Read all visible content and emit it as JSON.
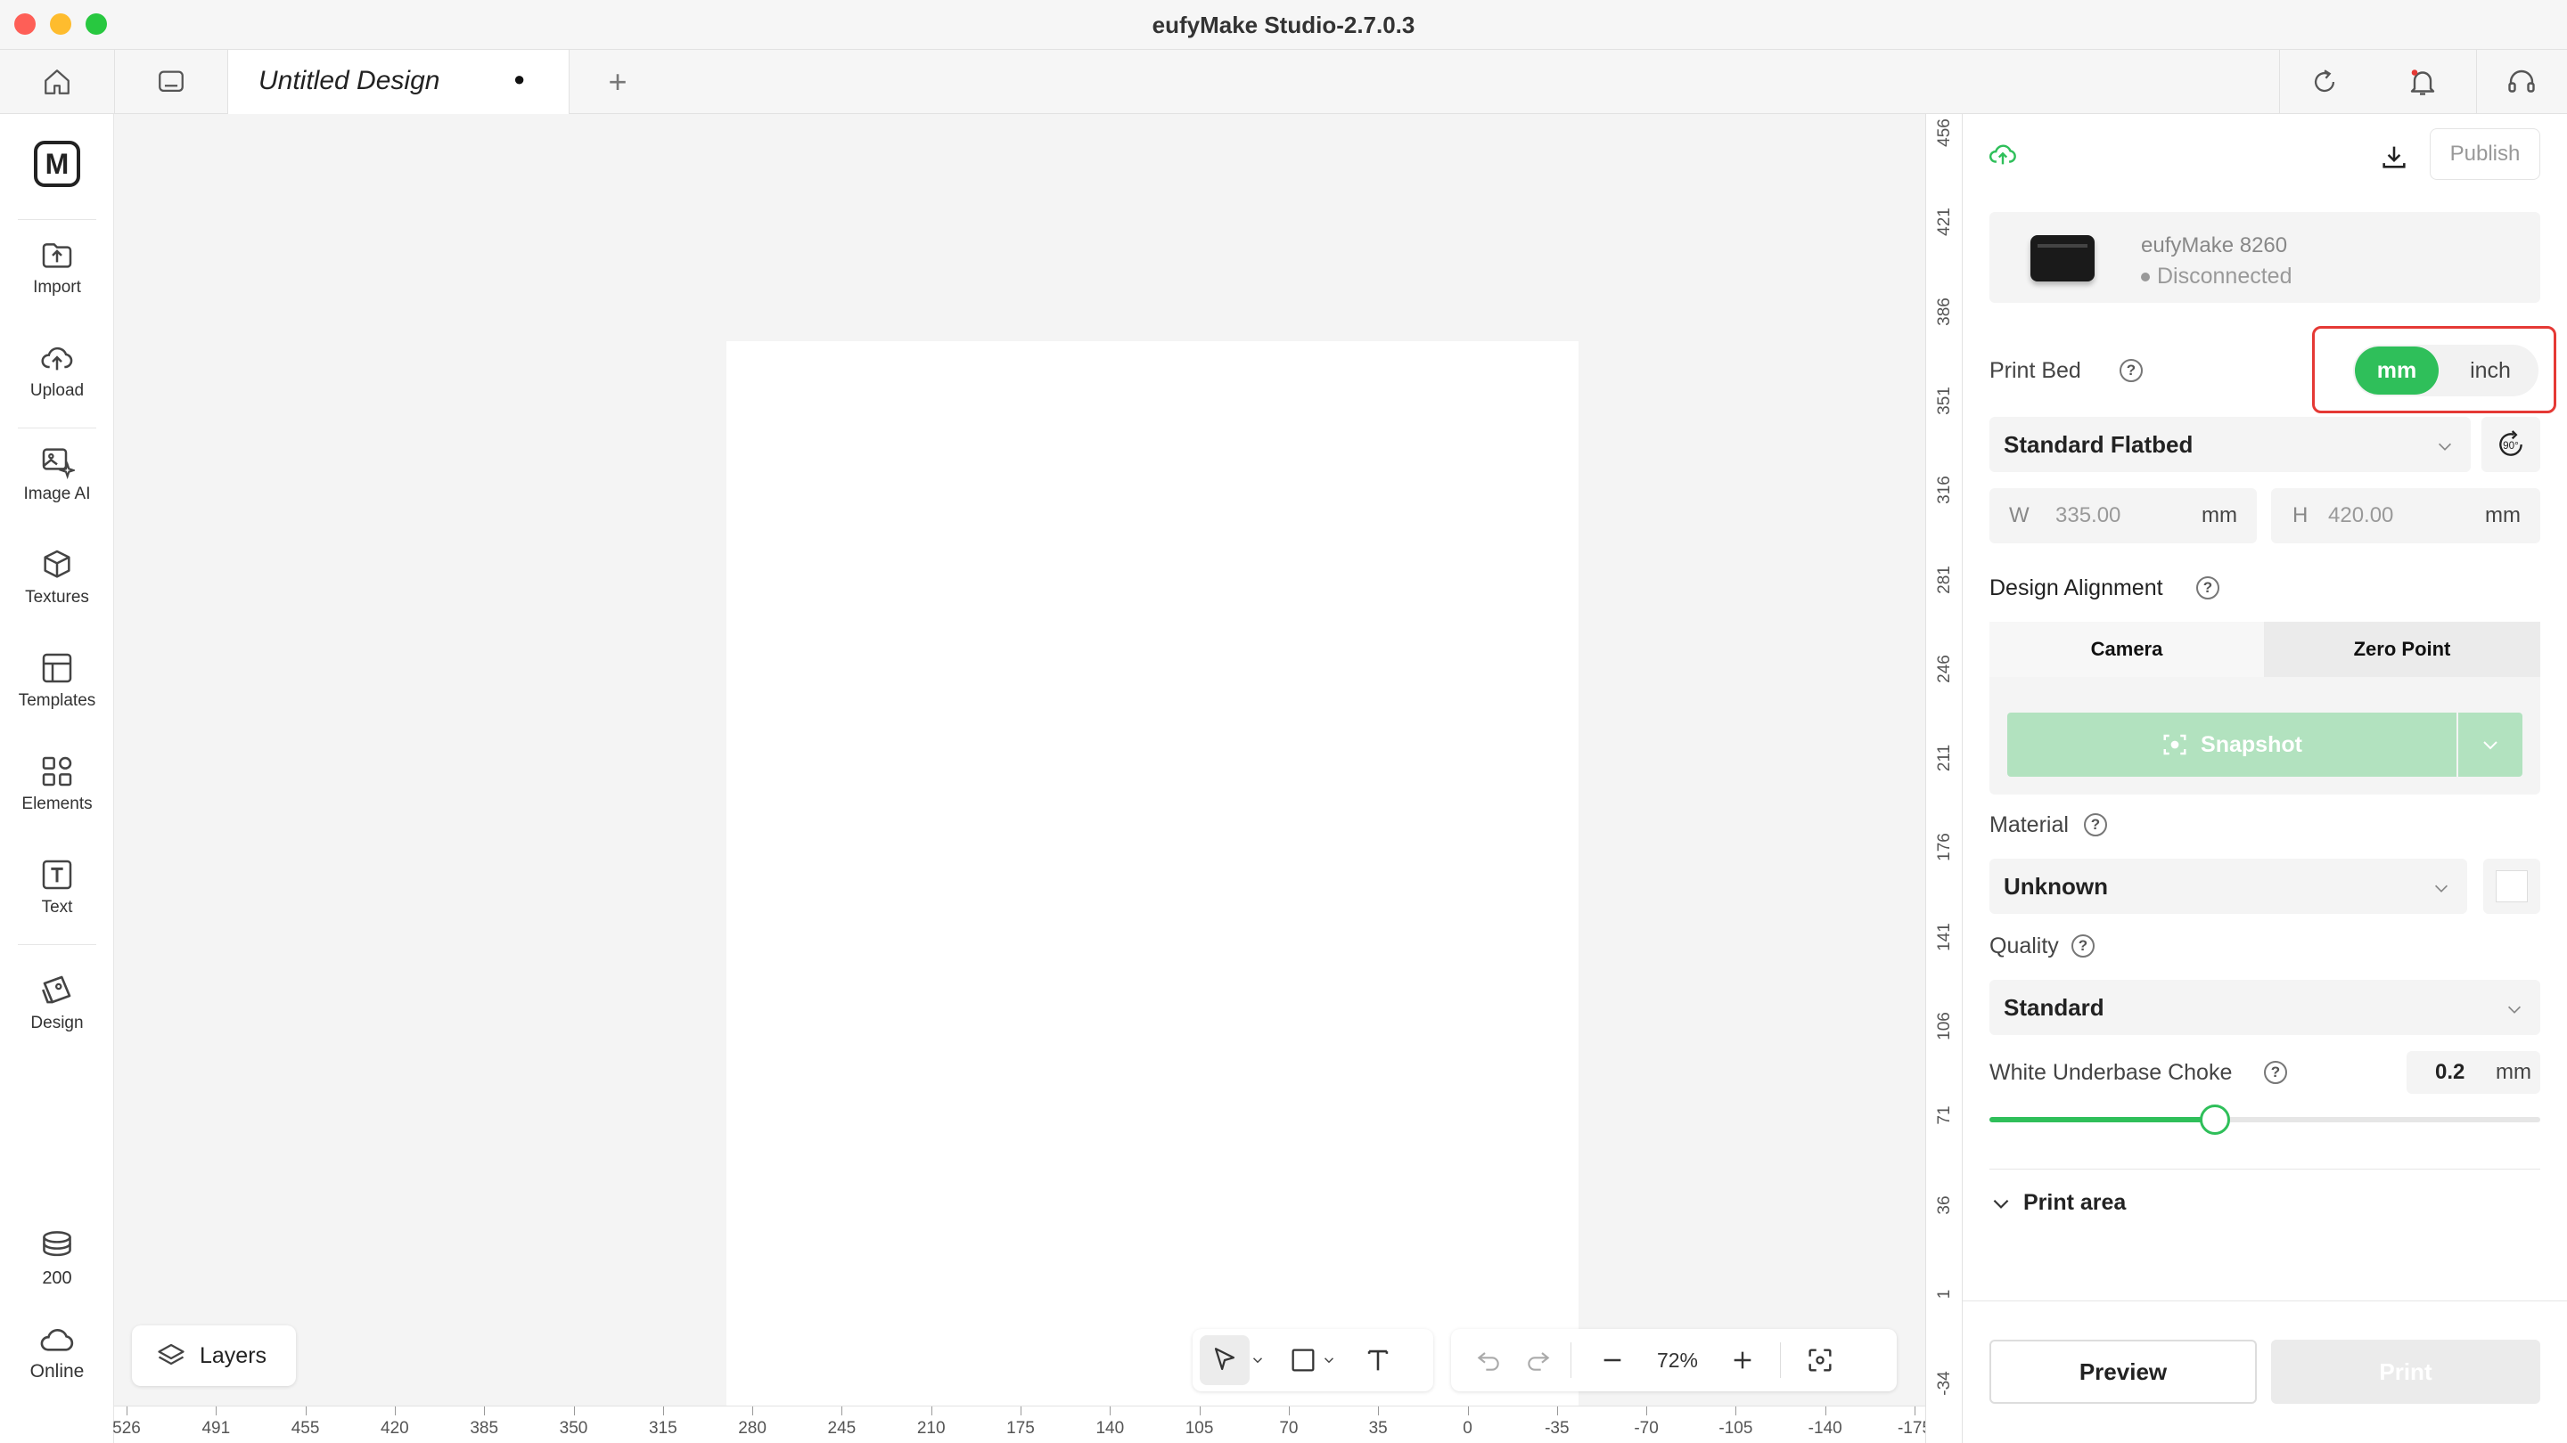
{
  "window": {
    "title": "eufyMake Studio-2.7.0.3"
  },
  "tabbar": {
    "tab_title": "Untitled Design",
    "tab_modified_dot": "●",
    "new_tab": "+"
  },
  "sidebar": {
    "logo": "M",
    "items": [
      {
        "label": "Import",
        "icon": "import-icon"
      },
      {
        "label": "Upload",
        "icon": "upload-cloud-icon"
      },
      {
        "label": "Image AI",
        "icon": "image-ai-icon"
      },
      {
        "label": "Textures",
        "icon": "textures-icon"
      },
      {
        "label": "Templates",
        "icon": "templates-icon"
      },
      {
        "label": "Elements",
        "icon": "elements-icon"
      },
      {
        "label": "Text",
        "icon": "text-icon"
      },
      {
        "label": "Design",
        "icon": "design-icon"
      }
    ],
    "coins": "200",
    "online": "Online"
  },
  "canvas": {
    "layers_label": "Layers",
    "zoom": "72%",
    "hruler_labels": [
      "526",
      "491",
      "455",
      "420",
      "385",
      "350",
      "315",
      "280",
      "245",
      "210",
      "175",
      "140",
      "105",
      "70",
      "35",
      "0",
      "-35",
      "-70",
      "-105",
      "-140",
      "-175"
    ],
    "vruler_labels": [
      "456",
      "421",
      "386",
      "351",
      "316",
      "281",
      "246",
      "211",
      "176",
      "141",
      "106",
      "71",
      "36",
      "1",
      "-34"
    ]
  },
  "panel": {
    "publish": "Publish",
    "printer_name": "eufyMake 8260",
    "printer_status": "Disconnected",
    "print_bed_label": "Print Bed",
    "unit_mm": "mm",
    "unit_inch": "inch",
    "bed_type": "Standard Flatbed",
    "rotate_label": "90°",
    "w_label": "W",
    "w_value": "335.00",
    "w_unit": "mm",
    "h_label": "H",
    "h_value": "420.00",
    "h_unit": "mm",
    "alignment_label": "Design Alignment",
    "tab_camera": "Camera",
    "tab_zero": "Zero Point",
    "snapshot": "Snapshot",
    "material_label": "Material",
    "material_value": "Unknown",
    "quality_label": "Quality",
    "quality_value": "Standard",
    "choke_label": "White Underbase Choke",
    "choke_value": "0.2",
    "choke_unit": "mm",
    "choke_slider_fraction": 0.41,
    "print_area": "Print area",
    "preview": "Preview",
    "print": "Print"
  },
  "colors": {
    "accent": "#2fbf5a",
    "highlight": "#e53935"
  }
}
